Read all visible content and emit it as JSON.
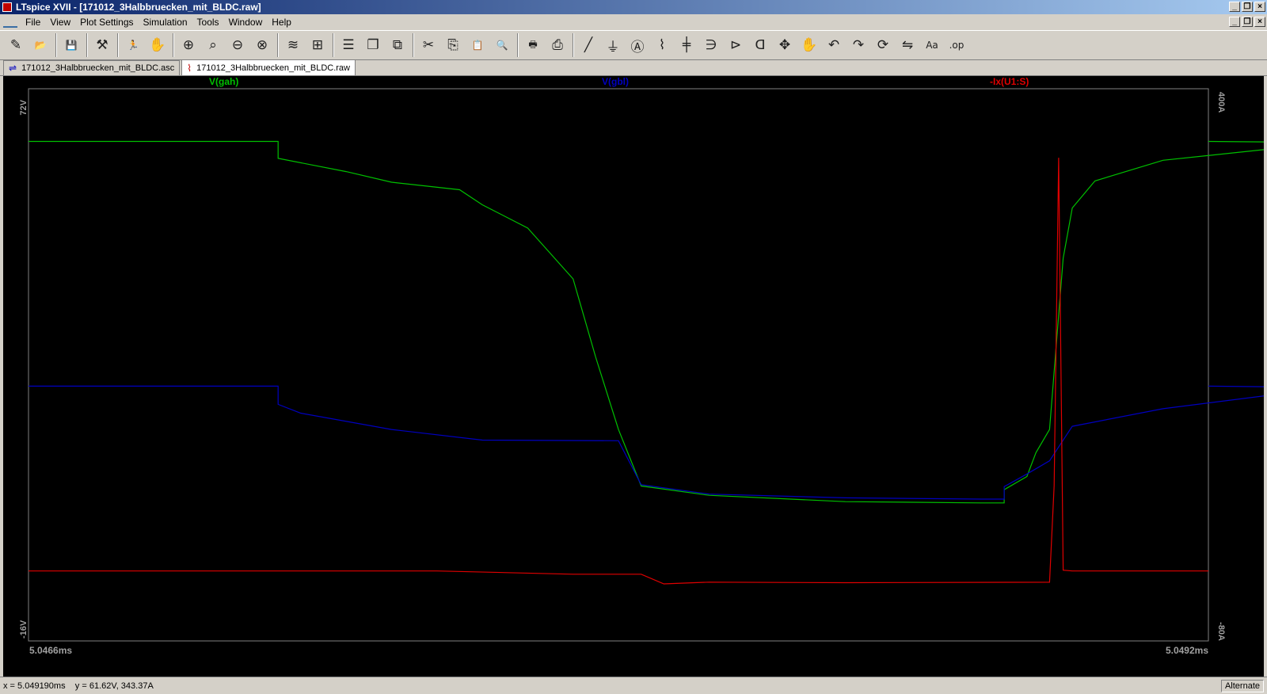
{
  "window": {
    "title": "LTspice XVII - [171012_3Halbbruecken_mit_BLDC.raw]"
  },
  "menu": [
    "File",
    "View",
    "Plot Settings",
    "Simulation",
    "Tools",
    "Window",
    "Help"
  ],
  "toolbar": {
    "groups": [
      [
        {
          "name": "new-schematic-icon",
          "glyph": "✎"
        },
        {
          "name": "open-icon",
          "glyph": "📂"
        }
      ],
      [
        {
          "name": "save-icon",
          "glyph": "💾"
        }
      ],
      [
        {
          "name": "control-panel-icon",
          "glyph": "⚒"
        }
      ],
      [
        {
          "name": "run-icon",
          "glyph": "🏃"
        },
        {
          "name": "halt-icon",
          "glyph": "✋"
        }
      ],
      [
        {
          "name": "zoom-area-icon",
          "glyph": "⊕"
        },
        {
          "name": "zoom-fit-icon",
          "glyph": "⌕"
        },
        {
          "name": "zoom-out-icon",
          "glyph": "⊖"
        },
        {
          "name": "zoom-cancel-icon",
          "glyph": "⊗"
        }
      ],
      [
        {
          "name": "autorange-icon",
          "glyph": "≋"
        },
        {
          "name": "mark-icon",
          "glyph": "⊞"
        }
      ],
      [
        {
          "name": "tile-horizontal-icon",
          "glyph": "☰"
        },
        {
          "name": "cascade-icon",
          "glyph": "❐"
        },
        {
          "name": "tile-vertical-icon",
          "glyph": "⧉"
        }
      ],
      [
        {
          "name": "cut-icon",
          "glyph": "✂"
        },
        {
          "name": "copy-icon",
          "glyph": "⎘"
        },
        {
          "name": "paste-icon",
          "glyph": "📋"
        },
        {
          "name": "find-icon",
          "glyph": "🔍"
        }
      ],
      [
        {
          "name": "print-preview-icon",
          "glyph": "🖶"
        },
        {
          "name": "print-icon",
          "glyph": "⎙"
        }
      ],
      [
        {
          "name": "wire-icon",
          "glyph": "╱"
        },
        {
          "name": "ground-icon",
          "glyph": "⏚"
        },
        {
          "name": "label-net-icon",
          "glyph": "Ⓐ"
        },
        {
          "name": "resistor-icon",
          "glyph": "⌇"
        },
        {
          "name": "capacitor-icon",
          "glyph": "╪"
        },
        {
          "name": "inductor-icon",
          "glyph": "∋"
        },
        {
          "name": "diode-icon",
          "glyph": "⊳"
        },
        {
          "name": "component-icon",
          "glyph": "ᗡ"
        },
        {
          "name": "move-icon",
          "glyph": "✥"
        },
        {
          "name": "drag-icon",
          "glyph": "✋"
        },
        {
          "name": "undo-icon",
          "glyph": "↶"
        },
        {
          "name": "redo-icon",
          "glyph": "↷"
        },
        {
          "name": "rotate-icon",
          "glyph": "⟳"
        },
        {
          "name": "mirror-icon",
          "glyph": "⇋"
        },
        {
          "name": "text-icon",
          "glyph": "Aa"
        },
        {
          "name": "spice-directive-icon",
          "glyph": ".op"
        }
      ]
    ]
  },
  "tabs": [
    {
      "label": "171012_3Halbbruecken_mit_BLDC.asc",
      "icon": "schematic-tab-icon",
      "glyph": "⇌"
    },
    {
      "label": "171012_3Halbbruecken_mit_BLDC.raw",
      "icon": "waveform-tab-icon",
      "glyph": "⌇"
    }
  ],
  "plot": {
    "traces": [
      {
        "name": "V(gah)",
        "color": "#00c000"
      },
      {
        "name": "V(gbl)",
        "color": "#0000c0"
      },
      {
        "name": "-Ix(U1:S)",
        "color": "#e00000"
      }
    ],
    "left_top": "72V",
    "left_bottom": "-16V",
    "right_top": "400A",
    "right_bottom": "-80A",
    "x_start": "5.0466ms",
    "x_end": "5.0492ms"
  },
  "chart_data": {
    "type": "line",
    "title": "",
    "xlabel": "",
    "ylabel": "",
    "xlim": [
      5.0466,
      5.0492
    ],
    "ylim_left": [
      -16,
      72
    ],
    "ylim_right": [
      -80,
      400
    ],
    "series": [
      {
        "name": "V(gah)",
        "axis": "left",
        "color": "#00c000",
        "points": [
          [
            5.0466,
            63.6
          ],
          [
            5.04715,
            63.6
          ],
          [
            5.04715,
            60.9
          ],
          [
            5.0473,
            58.8
          ],
          [
            5.0474,
            57.1
          ],
          [
            5.04755,
            55.9
          ],
          [
            5.0476,
            53.5
          ],
          [
            5.0477,
            49.8
          ],
          [
            5.0478,
            41.7
          ],
          [
            5.04785,
            29.2
          ],
          [
            5.0479,
            17.7
          ],
          [
            5.04795,
            8.7
          ],
          [
            5.0481,
            7.2
          ],
          [
            5.0484,
            6.2
          ],
          [
            5.0487,
            6.0
          ],
          [
            5.04875,
            6.0
          ],
          [
            5.04875,
            8.1
          ],
          [
            5.0488,
            10.2
          ],
          [
            5.04882,
            14.0
          ],
          [
            5.04885,
            17.7
          ],
          [
            5.04888,
            45.0
          ],
          [
            5.0489,
            53.0
          ],
          [
            5.04895,
            57.3
          ],
          [
            5.0491,
            60.6
          ],
          [
            5.04935,
            62.5
          ],
          [
            5.04965,
            63.3
          ],
          [
            5.0492,
            63.6
          ]
        ]
      },
      {
        "name": "V(gbl)",
        "axis": "left",
        "color": "#0000c0",
        "points": [
          [
            5.0466,
            24.6
          ],
          [
            5.04715,
            24.6
          ],
          [
            5.04715,
            21.7
          ],
          [
            5.0472,
            20.3
          ],
          [
            5.0474,
            17.7
          ],
          [
            5.0476,
            16.0
          ],
          [
            5.0479,
            15.9
          ],
          [
            5.04795,
            8.9
          ],
          [
            5.0481,
            7.4
          ],
          [
            5.0484,
            6.8
          ],
          [
            5.0487,
            6.6
          ],
          [
            5.04875,
            6.6
          ],
          [
            5.04875,
            8.6
          ],
          [
            5.0488,
            10.6
          ],
          [
            5.04885,
            12.7
          ],
          [
            5.0489,
            18.2
          ],
          [
            5.0491,
            21.0
          ],
          [
            5.04935,
            23.3
          ],
          [
            5.0496,
            24.3
          ],
          [
            5.0492,
            24.6
          ]
        ]
      },
      {
        "name": "-Ix(U1:S)",
        "axis": "right",
        "color": "#e00000",
        "points": [
          [
            5.0466,
            -19.2
          ],
          [
            5.0475,
            -19.2
          ],
          [
            5.0478,
            -22.0
          ],
          [
            5.04795,
            -22.0
          ],
          [
            5.048,
            -30.4
          ],
          [
            5.0481,
            -28.9
          ],
          [
            5.0484,
            -29.4
          ],
          [
            5.04885,
            -29.0
          ],
          [
            5.04886,
            55.0
          ],
          [
            5.04887,
            340.0
          ],
          [
            5.04888,
            -18.5
          ],
          [
            5.0489,
            -19.2
          ],
          [
            5.0492,
            -19.2
          ]
        ]
      }
    ]
  },
  "status": {
    "cursor": "x = 5.049190ms    y = 61.62V, 343.37A",
    "mode": "Alternate"
  }
}
